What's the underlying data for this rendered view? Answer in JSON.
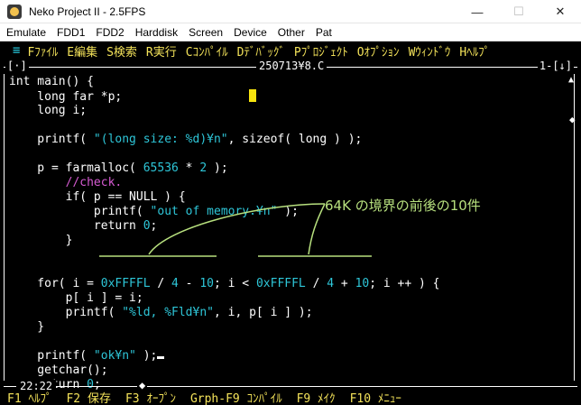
{
  "window": {
    "title": "Neko Project II - 2.5FPS",
    "minimize_glyph": "—",
    "maximize_glyph": "☐",
    "close_glyph": "✕"
  },
  "menu": [
    "Emulate",
    "FDD1",
    "FDD2",
    "Harddisk",
    "Screen",
    "Device",
    "Other",
    "Pat"
  ],
  "function_bar": {
    "menu_glyph": "≡",
    "items": [
      "Fﾌｧｲﾙ",
      "E編集",
      "S検索",
      "R実行",
      "Cｺﾝﾊﾟｲﾙ",
      "Dﾃﾞﾊﾞｯｸﾞ",
      "Pﾌﾟﾛｼﾞｪｸﾄ",
      "Oｵﾌﾟｼｮﾝ",
      "Wｳｨﾝﾄﾞｳ",
      "Hﾍﾙﾌﾟ"
    ]
  },
  "editor": {
    "left_tag": "[·]",
    "filename": "250713¥8.C",
    "right_tag": "1-[↓]",
    "position": "22:22",
    "bottom_mark": "◆",
    "scroll_up": "▲",
    "scroll_thumb": "◆"
  },
  "code": [
    [
      {
        "t": "int main() {"
      }
    ],
    [
      {
        "t": "    long far *p;"
      }
    ],
    [
      {
        "t": "    long i;"
      }
    ],
    [
      {
        "t": ""
      }
    ],
    [
      {
        "t": "    printf( "
      },
      {
        "t": "\"(long size: %d)¥n\"",
        "c": "cyan"
      },
      {
        "t": ", sizeof( long ) );"
      }
    ],
    [
      {
        "t": ""
      }
    ],
    [
      {
        "t": "    p = farmalloc( "
      },
      {
        "t": "65536",
        "c": "cyan"
      },
      {
        "t": " * "
      },
      {
        "t": "2",
        "c": "cyan"
      },
      {
        "t": " );"
      }
    ],
    [
      {
        "t": "        "
      },
      {
        "t": "//check.",
        "c": "magenta"
      }
    ],
    [
      {
        "t": "        if( p == NULL ) {"
      }
    ],
    [
      {
        "t": "            printf( "
      },
      {
        "t": "\"out of memory.¥n\"",
        "c": "cyan"
      },
      {
        "t": " );"
      }
    ],
    [
      {
        "t": "            return "
      },
      {
        "t": "0",
        "c": "cyan"
      },
      {
        "t": ";"
      }
    ],
    [
      {
        "t": "        }"
      }
    ],
    [
      {
        "t": ""
      }
    ],
    [
      {
        "t": ""
      }
    ],
    [
      {
        "t": "    for( i = "
      },
      {
        "t": "0xFFFFL",
        "c": "cyan"
      },
      {
        "t": " / "
      },
      {
        "t": "4",
        "c": "cyan"
      },
      {
        "t": " - "
      },
      {
        "t": "10",
        "c": "cyan"
      },
      {
        "t": "; i < "
      },
      {
        "t": "0xFFFFL",
        "c": "cyan"
      },
      {
        "t": " / "
      },
      {
        "t": "4",
        "c": "cyan"
      },
      {
        "t": " + "
      },
      {
        "t": "10",
        "c": "cyan"
      },
      {
        "t": "; i ++ ) {"
      }
    ],
    [
      {
        "t": "        p[ i ] = i;"
      }
    ],
    [
      {
        "t": "        printf( "
      },
      {
        "t": "\"%ld, %Fld¥n\"",
        "c": "cyan"
      },
      {
        "t": ", i, p[ i ] );"
      }
    ],
    [
      {
        "t": "    }"
      }
    ],
    [
      {
        "t": ""
      }
    ],
    [
      {
        "t": "    printf( "
      },
      {
        "t": "\"ok¥n\"",
        "c": "cyan"
      },
      {
        "t": " );"
      }
    ],
    [
      {
        "t": "    getchar();"
      }
    ],
    [
      {
        "t": "    return "
      },
      {
        "t": "0",
        "c": "cyan"
      },
      {
        "t": ";"
      }
    ]
  ],
  "annotation": "64K の境界の前後の10件",
  "keys": [
    "F1 ﾍﾙﾌﾟ",
    "F2 保存",
    "F3 ｵｰﾌﾟﾝ",
    "Grph-F9 ｺﾝﾊﾟｲﾙ",
    "F9 ﾒｲｸ",
    "F10 ﾒﾆｭｰ"
  ],
  "colors": {
    "function_key": "#f4e35a",
    "literal": "#2ec6d8",
    "comment": "#d65bd2",
    "annotation": "#b7e07e",
    "cursor": "#f7e40e"
  }
}
